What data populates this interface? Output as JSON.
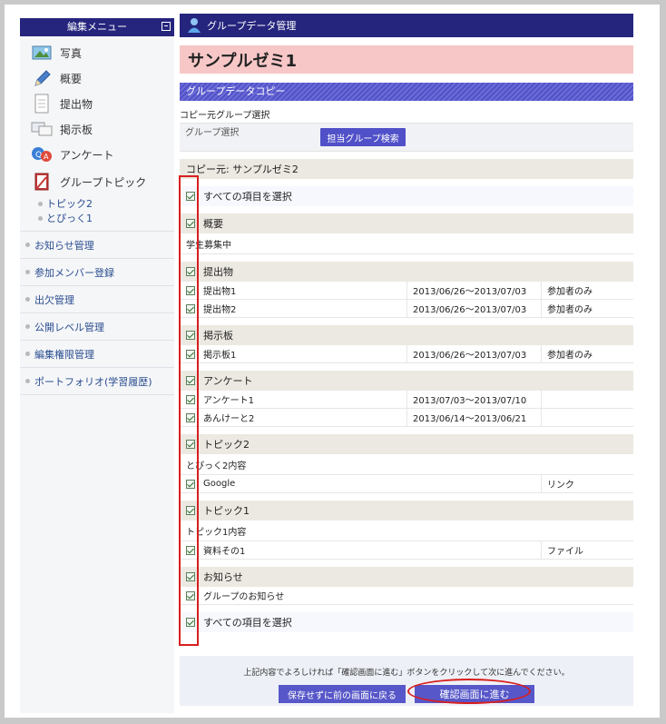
{
  "sidebar": {
    "title": "編集メニュー",
    "items": [
      {
        "label": "写真",
        "icon": "photo-icon"
      },
      {
        "label": "概要",
        "icon": "pencil-icon"
      },
      {
        "label": "提出物",
        "icon": "document-icon"
      },
      {
        "label": "掲示板",
        "icon": "board-icon"
      },
      {
        "label": "アンケート",
        "icon": "qa-icon"
      },
      {
        "label": "グループトピック",
        "icon": "notebook-icon"
      }
    ],
    "subitems": [
      "トピック2",
      "とぴっく1"
    ],
    "links": [
      "お知らせ管理",
      "参加メンバー登録",
      "出欠管理",
      "公開レベル管理",
      "編集権限管理",
      "ポートフォリオ(学習履歴)"
    ]
  },
  "header": {
    "title": "グループデータ管理",
    "icon": "user-avatar-icon"
  },
  "page_title": "サンプルゼミ1",
  "section_band": "グループデータコピー",
  "copy_source_label": "コピー元グループ選択",
  "group_select_label": "グループ選択",
  "search_button": "担当グループ検索",
  "copy_from": "コピー元: サンプルゼミ2",
  "select_all": "すべての項目を選択",
  "overview": {
    "label": "概要",
    "note": "学生募集中"
  },
  "submissions": {
    "label": "提出物",
    "rows": [
      {
        "name": "提出物1",
        "period": "2013/06/26〜2013/07/03",
        "scope": "参加者のみ"
      },
      {
        "name": "提出物2",
        "period": "2013/06/26〜2013/07/03",
        "scope": "参加者のみ"
      }
    ]
  },
  "board": {
    "label": "掲示板",
    "rows": [
      {
        "name": "掲示板1",
        "period": "2013/06/26〜2013/07/03",
        "scope": "参加者のみ"
      }
    ]
  },
  "survey": {
    "label": "アンケート",
    "rows": [
      {
        "name": "アンケート1",
        "period": "2013/07/03〜2013/07/10",
        "scope": ""
      },
      {
        "name": "あんけーと2",
        "period": "2013/06/14〜2013/06/21",
        "scope": ""
      }
    ]
  },
  "topic2": {
    "label": "トピック2",
    "note": "とぴっく2内容",
    "rows": [
      {
        "name": "Google",
        "type": "リンク"
      }
    ]
  },
  "topic1": {
    "label": "トピック1",
    "note": "トピック1内容",
    "rows": [
      {
        "name": "資料その1",
        "type": "ファイル"
      }
    ]
  },
  "notice": {
    "label": "お知らせ",
    "rows": [
      {
        "name": "グループのお知らせ"
      }
    ]
  },
  "footer": {
    "message": "上記内容でよろしければ「確認画面に進む」ボタンをクリックして次に進んでください。",
    "back_button": "保存せずに前の画面に戻る",
    "confirm_button": "確認画面に進む"
  },
  "colors": {
    "nav": "#25257e",
    "accent": "#5757c9",
    "highlight": "#d81e1e",
    "title_bg": "#f7c7c7"
  }
}
